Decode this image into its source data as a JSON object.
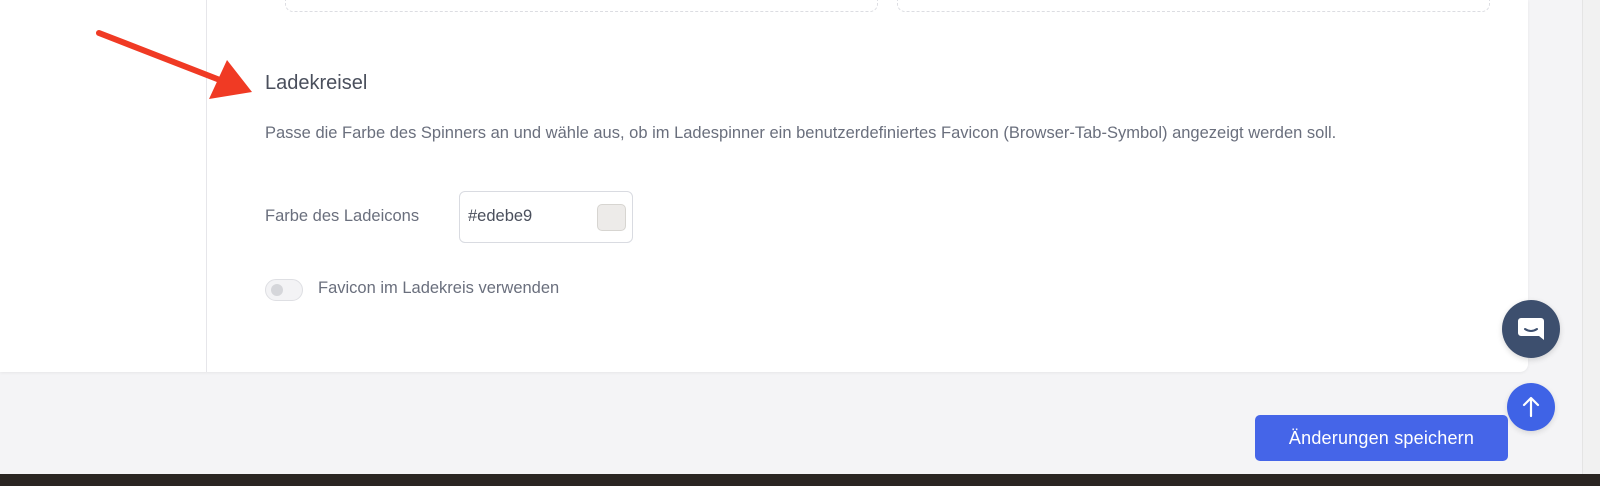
{
  "section": {
    "title": "Ladekreisel",
    "description": "Passe die Farbe des Spinners an und wähle aus, ob im Ladespinner ein benutzerdefiniertes Favicon (Browser-Tab-Symbol) angezeigt werden soll."
  },
  "spinner_color": {
    "label": "Farbe des Ladeicons",
    "value": "#edebe9",
    "swatch_color": "#edebe9"
  },
  "favicon_toggle": {
    "label": "Favicon im Ladekreis verwenden",
    "enabled": false
  },
  "footer": {
    "save_label": "Änderungen speichern"
  },
  "colors": {
    "accent": "#4565e8",
    "chat_button": "#3d4f6e",
    "annotation_arrow": "#f03a24"
  },
  "icons": {
    "chat": "chat-bubble-icon",
    "scroll_top": "arrow-up-icon",
    "annotation": "red-arrow-annotation"
  }
}
